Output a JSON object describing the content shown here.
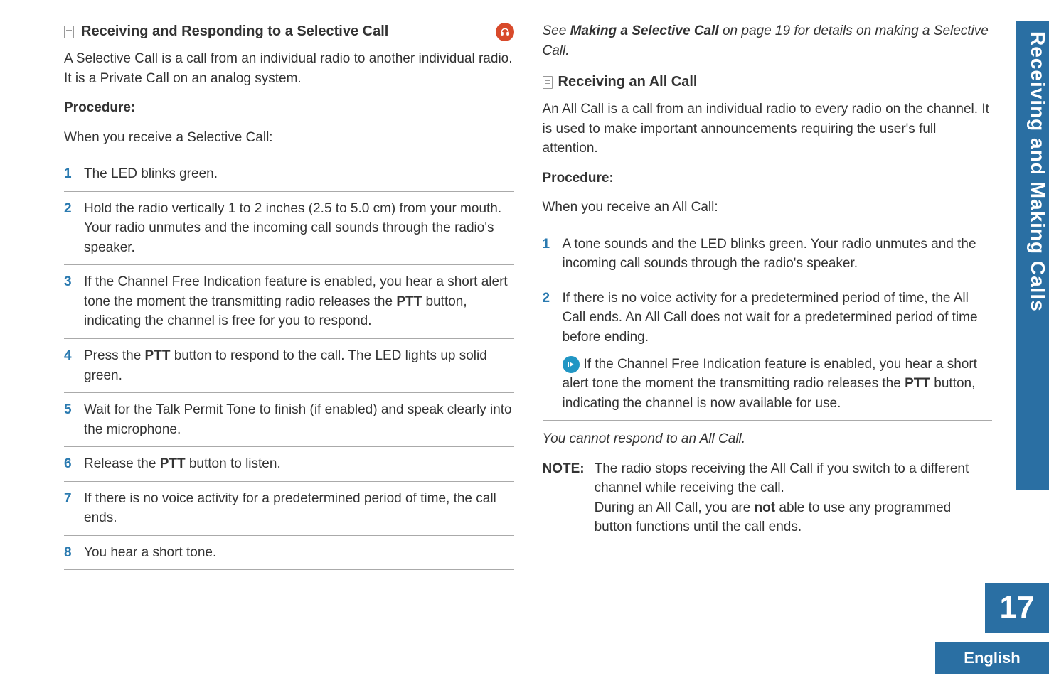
{
  "left": {
    "heading": "Receiving and Responding to a Selective Call",
    "intro": "A Selective Call is a call from an individual radio to another individual radio. It is a Private Call on an analog system.",
    "procedure_label": "Procedure:",
    "when_text": "When you receive a Selective Call:",
    "steps": {
      "s1": "The LED blinks green.",
      "s2": "Hold the radio vertically 1 to 2 inches (2.5 to 5.0 cm) from your mouth. Your radio unmutes and the incoming call sounds through the radio's speaker.",
      "s3_a": "If the Channel Free Indication feature is enabled, you hear a short alert tone the moment the transmitting radio releases the ",
      "s3_b": "PTT",
      "s3_c": " button, indicating the channel is free for you to respond.",
      "s4_a": "Press the ",
      "s4_b": "PTT",
      "s4_c": " button to respond to the call. The LED lights up solid green.",
      "s5": "Wait for the Talk Permit Tone to finish (if enabled) and speak clearly into the microphone.",
      "s6_a": "Release the ",
      "s6_b": "PTT",
      "s6_c": " button to listen.",
      "s7": "If there is no voice activity for a predetermined period of time, the call ends.",
      "s8": "You hear a short tone."
    }
  },
  "right": {
    "see_a": "See ",
    "see_b": "Making a Selective Call",
    "see_c": " on page 19 for details on making a Selective Call.",
    "heading": "Receiving an All Call",
    "intro": "An All Call is a call from an individual radio to every radio on the channel. It is used to make important announcements requiring the user's full attention.",
    "procedure_label": "Procedure:",
    "when_text": "When you receive an All Call:",
    "steps": {
      "s1": "A tone sounds and the LED blinks green. Your radio unmutes and the incoming call sounds through the radio's speaker.",
      "s2_main": "If there is no voice activity for a predetermined period of time, the All Call ends. An All Call does not wait for a predetermined period of time before ending.",
      "s2_note_a": "If the Channel Free Indication feature is enabled, you hear a short alert tone the moment the transmitting radio releases the ",
      "s2_note_b": "PTT",
      "s2_note_c": " button, indicating the channel is now available for use."
    },
    "cannot": "You cannot respond to an All Call.",
    "note_label": "NOTE:",
    "note_a": "The radio stops receiving the All Call if you switch to a different channel while receiving the call.",
    "note_b1": "During an All Call, you are ",
    "note_b2": "not",
    "note_b3": " able to use any programmed button functions until the call ends."
  },
  "sidebar": "Receiving and Making Calls",
  "page_number": "17",
  "language": "English"
}
